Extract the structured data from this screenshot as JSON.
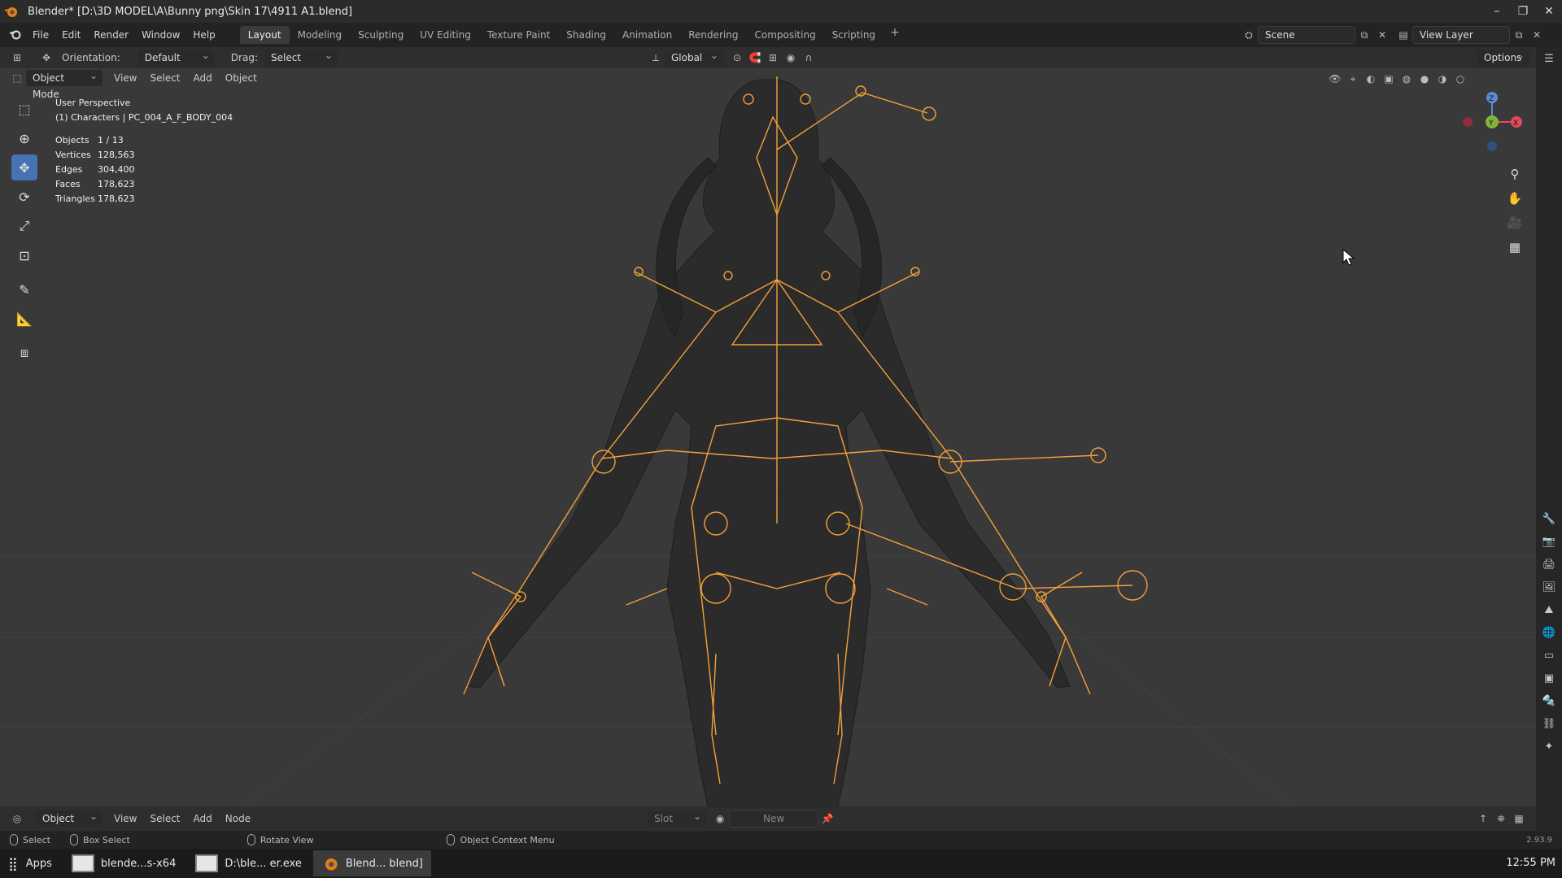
{
  "window": {
    "title": "Blender* [D:\\3D MODEL\\A\\Bunny png\\Skin 17\\4911 A1.blend]",
    "controls": [
      "–",
      "❐",
      "✕"
    ]
  },
  "menu": {
    "items": [
      "File",
      "Edit",
      "Render",
      "Window",
      "Help"
    ],
    "tabs": [
      "Layout",
      "Modeling",
      "Sculpting",
      "UV Editing",
      "Texture Paint",
      "Shading",
      "Animation",
      "Rendering",
      "Compositing",
      "Scripting"
    ],
    "active_tab": "Layout",
    "add_tab": "+",
    "scene": "Scene",
    "view_layer": "View Layer"
  },
  "tool_header": {
    "orientation_label": "Orientation:",
    "orientation_value": "Default",
    "drag_label": "Drag:",
    "drag_value": "Select Box",
    "transform_orientation": "Global",
    "options": "Options"
  },
  "viewport_header": {
    "mode": "Object Mode",
    "menus": [
      "View",
      "Select",
      "Add",
      "Object"
    ]
  },
  "viewport": {
    "perspective": "User Perspective",
    "collection": "(1) Characters | PC_004_A_F_BODY_004",
    "stats": [
      {
        "label": "Objects",
        "value": "1 / 13"
      },
      {
        "label": "Vertices",
        "value": "128,563"
      },
      {
        "label": "Edges",
        "value": "304,400"
      },
      {
        "label": "Faces",
        "value": "178,623"
      },
      {
        "label": "Triangles",
        "value": "178,623"
      }
    ],
    "gizmo": {
      "x": "X",
      "y": "Y",
      "z": "Z"
    }
  },
  "bottom_header": {
    "editor": "Object",
    "menus": [
      "View",
      "Select",
      "Add",
      "Node"
    ],
    "slot": "Slot",
    "new": "New",
    "version": "2.93.9"
  },
  "status": {
    "select": "Select",
    "box_select": "Box Select",
    "rotate": "Rotate View",
    "context": "Object Context Menu"
  },
  "taskbar": {
    "apps": "Apps",
    "items": [
      "blende...s-x64",
      "D:\\ble... er.exe",
      "Blend... blend]"
    ],
    "clock": "12:55 PM"
  },
  "colors": {
    "accent": "#4772b3",
    "bone": "#f3a13a",
    "viewport": "#393939"
  }
}
